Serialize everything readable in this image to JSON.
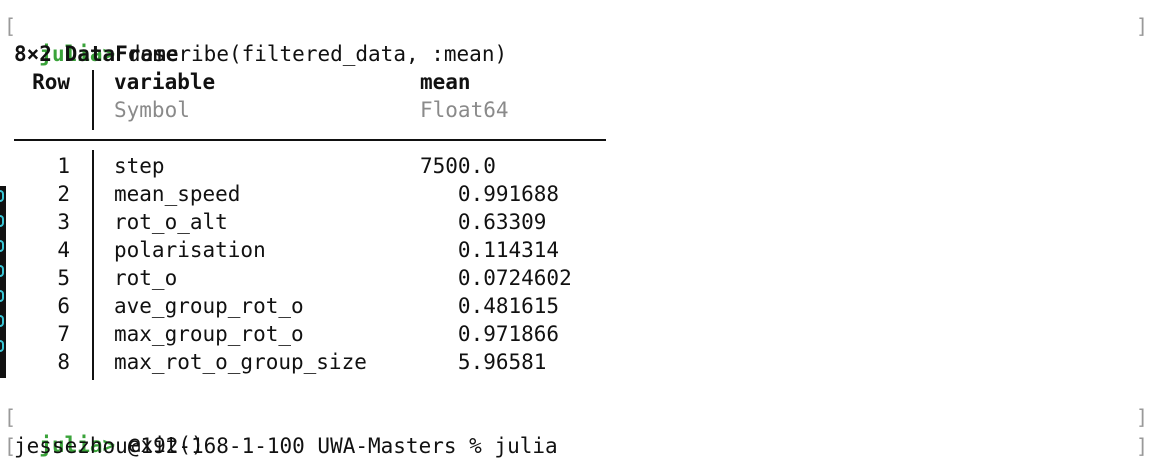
{
  "terminal": {
    "prompt_label": "julia>",
    "command_1": "describe(filtered_data, :mean)",
    "table_title": "8×2 DataFrame",
    "headers": {
      "row": "Row",
      "variable": "variable",
      "mean": "mean",
      "variable_type": "Symbol",
      "mean_type": "Float64"
    },
    "rows": [
      {
        "n": "1",
        "variable": "step",
        "mean": "7500.0"
      },
      {
        "n": "2",
        "variable": "mean_speed",
        "mean": "   0.991688"
      },
      {
        "n": "3",
        "variable": "rot_o_alt",
        "mean": "   0.63309"
      },
      {
        "n": "4",
        "variable": "polarisation",
        "mean": "   0.114314"
      },
      {
        "n": "5",
        "variable": "rot_o",
        "mean": "   0.0724602"
      },
      {
        "n": "6",
        "variable": "ave_group_rot_o",
        "mean": "   0.481615"
      },
      {
        "n": "7",
        "variable": "max_group_rot_o",
        "mean": "   0.971866"
      },
      {
        "n": "8",
        "variable": "max_rot_o_group_size",
        "mean": "   5.96581"
      }
    ],
    "command_2": "exit()",
    "shell_line": "jessezhou@192-168-1-100 UWA-Masters % julia"
  },
  "colors": {
    "prompt": "#3aa33a",
    "type_text": "#8a8a8a",
    "text": "#111111"
  }
}
